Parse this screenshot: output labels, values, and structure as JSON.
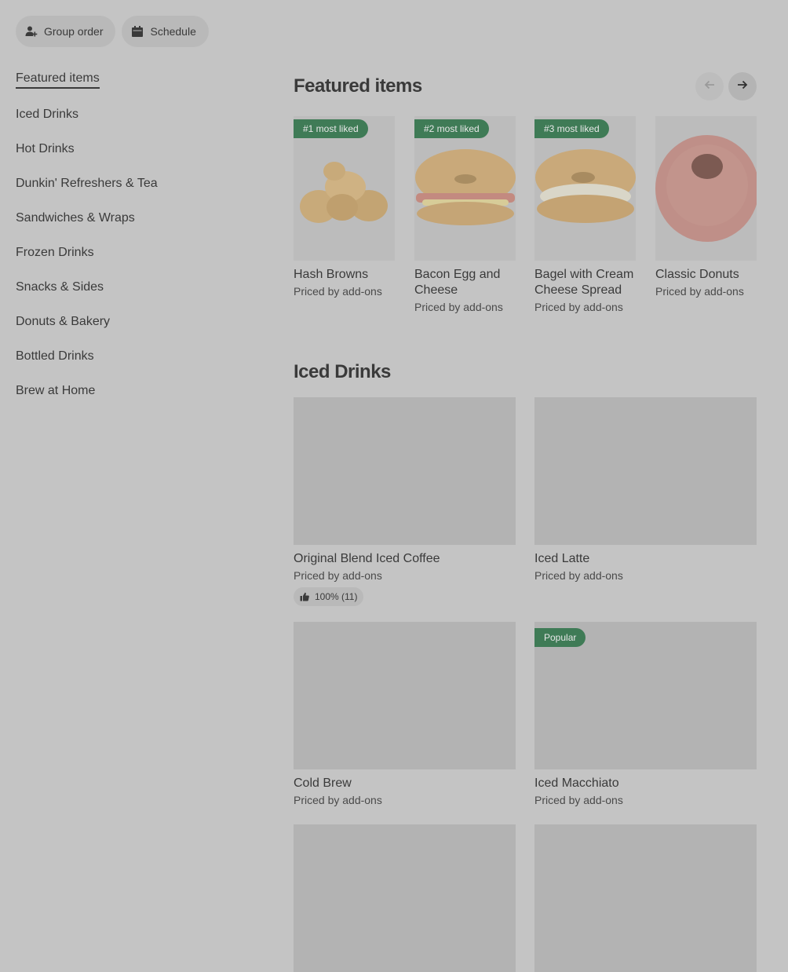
{
  "top_buttons": {
    "group_order": "Group order",
    "schedule": "Schedule"
  },
  "sidebar": {
    "items": [
      {
        "label": "Featured items"
      },
      {
        "label": "Iced Drinks"
      },
      {
        "label": "Hot Drinks"
      },
      {
        "label": "Dunkin' Refreshers & Tea"
      },
      {
        "label": "Sandwiches & Wraps"
      },
      {
        "label": "Frozen Drinks"
      },
      {
        "label": "Snacks & Sides"
      },
      {
        "label": "Donuts & Bakery"
      },
      {
        "label": "Bottled Drinks"
      },
      {
        "label": "Brew at Home"
      }
    ]
  },
  "featured": {
    "title": "Featured items",
    "items": [
      {
        "badge": "#1 most liked",
        "name": "Hash Browns",
        "price": "Priced by add-ons"
      },
      {
        "badge": "#2 most liked",
        "name": "Bacon Egg and Cheese",
        "price": "Priced by add-ons"
      },
      {
        "badge": "#3 most liked",
        "name": "Bagel with Cream Cheese Spread",
        "price": "Priced by add-ons"
      },
      {
        "name": "Classic Donuts",
        "price": "Priced by add-ons"
      }
    ]
  },
  "iced": {
    "title": "Iced Drinks",
    "items": [
      {
        "name": "Original Blend Iced Coffee",
        "price": "Priced by add-ons",
        "rating": "100% (11)"
      },
      {
        "name": "Iced Latte",
        "price": "Priced by add-ons"
      },
      {
        "name": "Cold Brew",
        "price": "Priced by add-ons"
      },
      {
        "badge": "Popular",
        "name": "Iced Macchiato",
        "price": "Priced by add-ons"
      }
    ]
  },
  "colors": {
    "background": "#c4c4c4",
    "badge": "#3f7b56",
    "text": "#3a3a3a"
  }
}
